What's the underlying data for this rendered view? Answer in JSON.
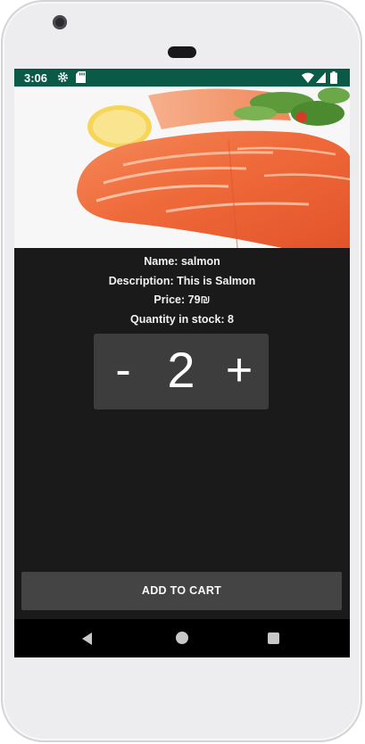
{
  "status_bar": {
    "time": "3:06",
    "icons": [
      "gear-icon",
      "sd-card-icon",
      "wifi-icon",
      "signal-icon",
      "battery-icon"
    ]
  },
  "product": {
    "image_icon": "salmon-photo",
    "name_line": "Name: salmon",
    "description_line": "Description: This is Salmon",
    "price_line": "Price: 79₪",
    "stock_line": "Quantity in stock: 8"
  },
  "quantity": {
    "decrement_label": "-",
    "value": "2",
    "increment_label": "+"
  },
  "actions": {
    "add_to_cart_label": "ADD TO CART"
  },
  "navigation": {
    "icons": [
      "back-icon",
      "home-icon",
      "recents-icon"
    ]
  },
  "colors": {
    "status_bar": "#0b5947",
    "background": "#1a1a1a",
    "quantity_box": "#3d3d3d",
    "button": "#444444",
    "nav_bar": "#000000"
  }
}
